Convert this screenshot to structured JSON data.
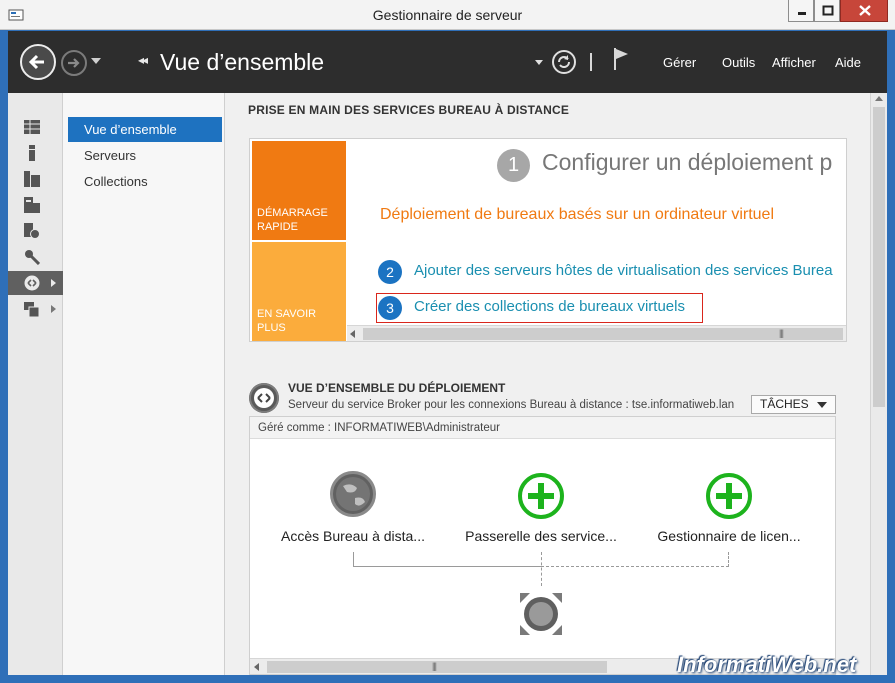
{
  "window": {
    "title": "Gestionnaire de serveur"
  },
  "header": {
    "breadcrumb": "Vue d’ensemble",
    "menus": [
      "Gérer",
      "Outils",
      "Afficher",
      "Aide"
    ]
  },
  "sidebar": {
    "items": [
      {
        "label": "Vue d’ensemble",
        "selected": true
      },
      {
        "label": "Serveurs",
        "selected": false
      },
      {
        "label": "Collections",
        "selected": false
      }
    ]
  },
  "quickstart": {
    "section_title": "PRISE EN MAIN DES SERVICES BUREAU À DISTANCE",
    "tile_start": "DÉMARRAGE RAPIDE",
    "tile_learn": "EN SAVOIR PLUS",
    "step1_number": "1",
    "heading": "Configurer un déploiement p",
    "subtitle": "Déploiement de bureaux basés sur un ordinateur virtuel",
    "step2_number": "2",
    "step2_link": "Ajouter des serveurs hôtes de virtualisation des services Burea",
    "step3_number": "3",
    "step3_link": "Créer des collections de bureaux virtuels"
  },
  "deployment": {
    "title": "VUE D’ENSEMBLE DU DÉPLOIEMENT",
    "subtitle": "Serveur du service Broker pour les connexions Bureau à distance : tse.informatiweb.lan",
    "tasks_label": "TÂCHES",
    "managed_as": "Géré comme : INFORMATIWEB\\Administrateur",
    "roles": [
      {
        "label": "Accès Bureau à dista..."
      },
      {
        "label": "Passerelle des service..."
      },
      {
        "label": "Gestionnaire de licen..."
      }
    ]
  },
  "watermark": "InformatiWeb.net",
  "colors": {
    "accent_blue": "#1e72c0",
    "orange": "#f07a12",
    "light_orange": "#fbac3c",
    "green": "#1db31d",
    "highlight_red": "#d9261c"
  }
}
